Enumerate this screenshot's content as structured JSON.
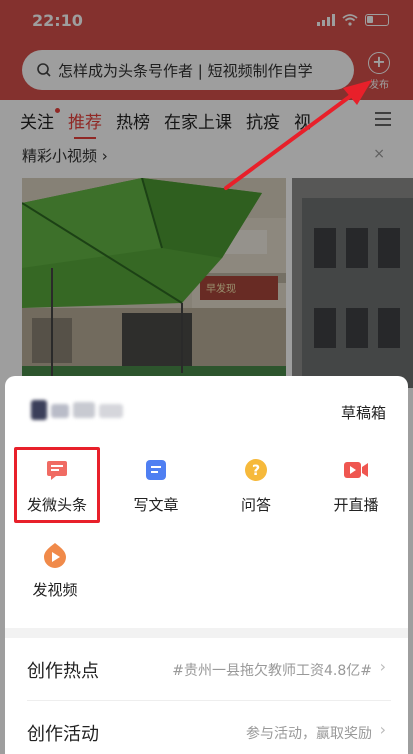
{
  "status": {
    "time": "22:10"
  },
  "header": {
    "search_text": "怎样成为头条号作者 | 短视频制作自学",
    "publish_label": "发布"
  },
  "tabs": [
    "关注",
    "推荐",
    "热榜",
    "在家上课",
    "抗疫",
    "视"
  ],
  "active_tab": "推荐",
  "feed": {
    "section_title": "精彩小视频 ›",
    "close": "×",
    "sign_text": "早发现"
  },
  "sheet": {
    "drafts_label": "草稿箱",
    "actions": [
      {
        "label": "发微头条",
        "icon": "micro-headline-icon",
        "color": "#f06b63"
      },
      {
        "label": "写文章",
        "icon": "article-icon",
        "color": "#4f7ff2"
      },
      {
        "label": "问答",
        "icon": "question-icon",
        "color": "#f6b93b"
      },
      {
        "label": "开直播",
        "icon": "live-stream-icon",
        "color": "#ef5650"
      },
      {
        "label": "发视频",
        "icon": "video-icon",
        "color": "#f08a4a"
      }
    ],
    "list": [
      {
        "title": "创作热点",
        "value": "#贵州一县拖欠教师工资4.8亿#",
        "chevron": "›"
      },
      {
        "title": "创作活动",
        "value": "参与活动，赢取奖励",
        "chevron": "›"
      }
    ]
  },
  "colors": {
    "header_red": "#d64f4b",
    "accent": "#e8423c",
    "annotation_red": "#e8202a"
  }
}
